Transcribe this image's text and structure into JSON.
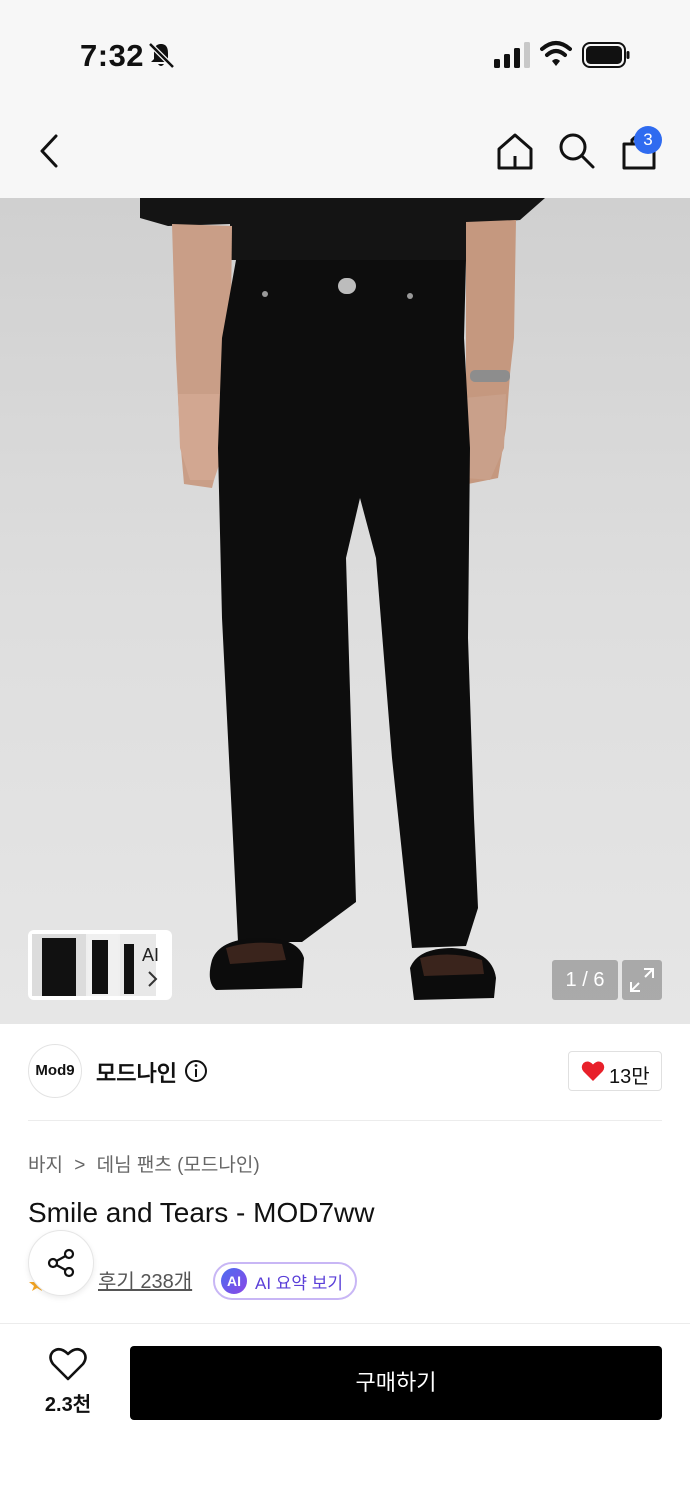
{
  "status": {
    "time": "7:32"
  },
  "nav": {
    "cart_count": "3"
  },
  "gallery": {
    "thumb_label": "AI",
    "page_indicator": "1 / 6"
  },
  "brand": {
    "logo_text": "Mod9",
    "name": "모드나인",
    "likes": "13만"
  },
  "breadcrumb": {
    "level1": "바지",
    "separator": ">",
    "level2": "데님 팬츠 (모드나인)"
  },
  "product": {
    "title": "Smile and Tears - MOD7ww",
    "review_label": "후기 238개",
    "ai_badge": "AI",
    "ai_summary_label": "AI 요약 보기"
  },
  "bottom": {
    "wish_count": "2.3천",
    "buy_label": "구매하기"
  },
  "colors": {
    "accent_blue": "#2f6bf0",
    "heart_red": "#e8202a",
    "ai_purple": "#5a3fd8",
    "buy_black": "#000000"
  }
}
